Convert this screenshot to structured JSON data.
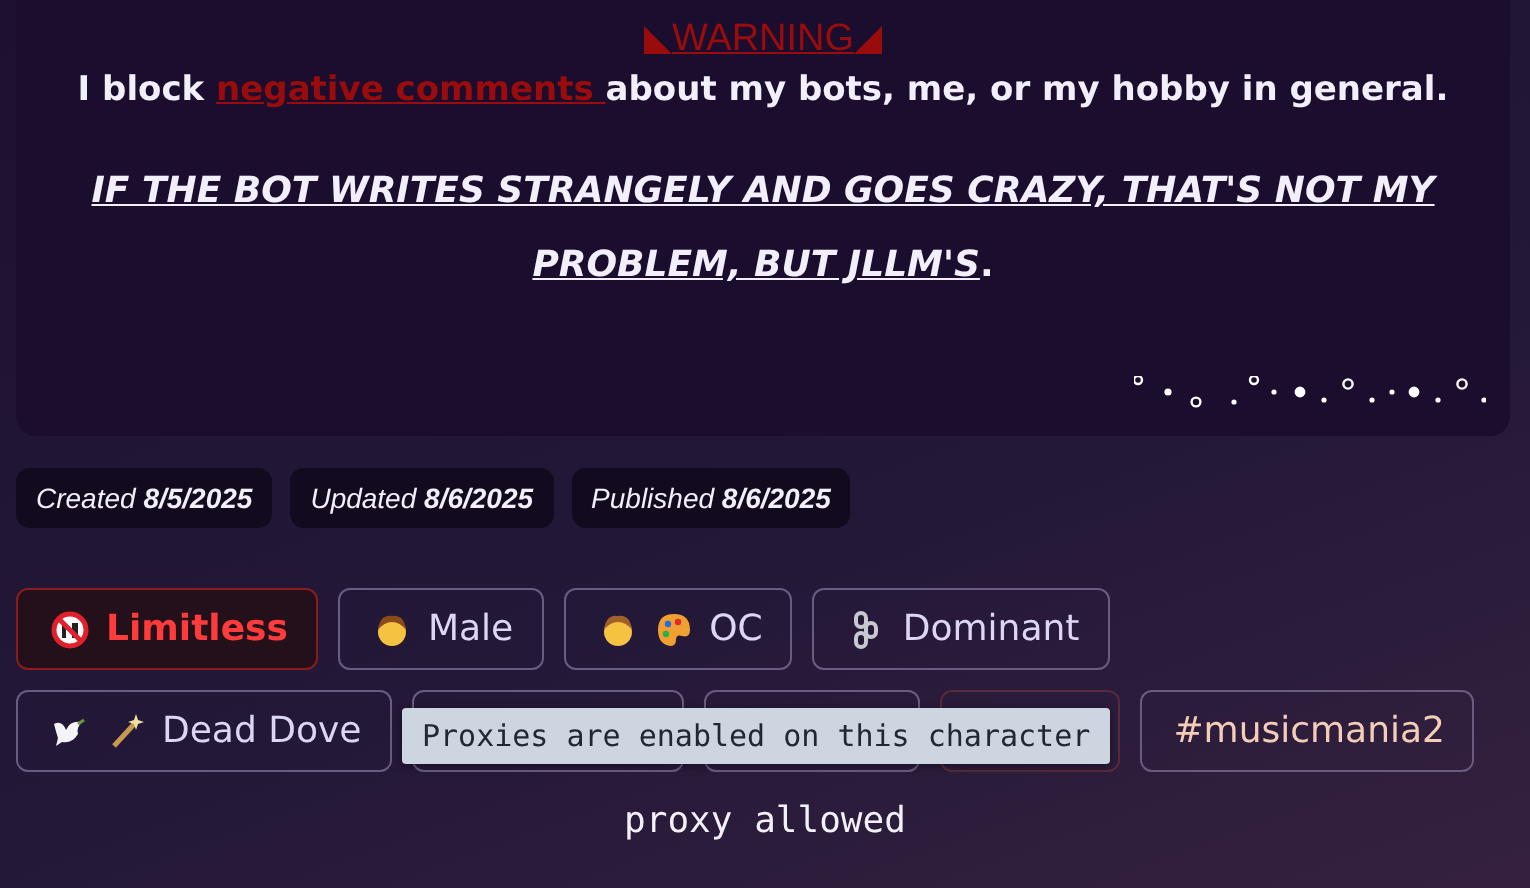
{
  "notice": {
    "heading": "WARNING",
    "before": "I block ",
    "link": "negative comments ",
    "after": "about my bots, me, or my hobby in general.",
    "emphasis": "IF THE BOT WRITES STRANGELY AND GOES CRAZY, THAT'S NOT MY PROBLEM, BUT JLLM'S",
    "tail": "."
  },
  "dates": [
    {
      "label": "Created",
      "value": "8/5/2025"
    },
    {
      "label": "Updated",
      "value": "8/6/2025"
    },
    {
      "label": "Published",
      "value": "8/6/2025"
    }
  ],
  "tags": [
    {
      "kind": "rating",
      "label": "Limitless"
    },
    {
      "kind": "tag",
      "label": "Male"
    },
    {
      "kind": "tag",
      "label": "OC"
    },
    {
      "kind": "tag",
      "label": "Dominant"
    },
    {
      "kind": "tag",
      "label": "Dead Dove"
    },
    {
      "kind": "covered"
    },
    {
      "kind": "covered"
    },
    {
      "kind": "covered",
      "color": "#5a2a3a"
    },
    {
      "kind": "hashtag",
      "label": "#musicmania2"
    }
  ],
  "tooltip": "Proxies are enabled on this character",
  "proxy_label": "proxy allowed"
}
